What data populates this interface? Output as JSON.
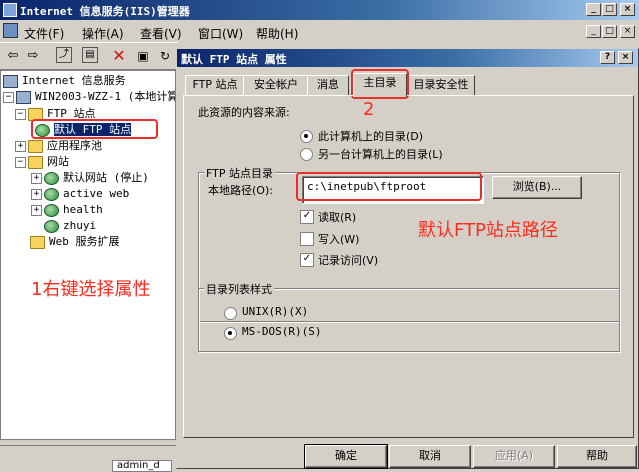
{
  "window": {
    "title": "Internet 信息服务(IIS)管理器",
    "controls": [
      "_",
      "□",
      "×"
    ],
    "inner_controls": [
      "_",
      "□",
      "×"
    ]
  },
  "menu": [
    "文件(F)",
    "操作(A)",
    "查看(V)",
    "窗口(W)",
    "帮助(H)"
  ],
  "toolbar_icons": [
    "back-icon",
    "forward-icon",
    "up-folder-icon",
    "show-tree-icon",
    "delete-icon",
    "properties-icon"
  ],
  "tree": {
    "root": "Internet 信息服务",
    "server": "WIN2003-WZZ-1 (本地计算机)",
    "ftp_sites": "FTP 站点",
    "default_ftp": "默认 FTP 站点",
    "app_pools": "应用程序池",
    "websites": "网站",
    "site1": "默认网站 (停止)",
    "site2": "active web",
    "site3": "health",
    "site4": "zhuyi",
    "web_ext": "Web 服务扩展"
  },
  "status": {
    "taskbar_item": "admin_d"
  },
  "annotations": {
    "step1": "1右键选择属性",
    "step2": "2",
    "path_note": "默认FTP站点路径",
    "color": "#ff2a1c"
  },
  "dialog": {
    "title": "默认 FTP 站点 属性",
    "help_btn": "?",
    "close_btn": "×",
    "tabs": [
      "FTP 站点",
      "安全帐户",
      "消息",
      "主目录",
      "目录安全性"
    ],
    "active_tab": "主目录",
    "content_source_label": "此资源的内容来源:",
    "radio_local": "此计算机上的目录(D)",
    "radio_share": "另一台计算机上的目录(L)",
    "ftp_dir_group": "FTP 站点目录",
    "local_path_label": "本地路径(O):",
    "local_path_value": "c:\\inetpub\\ftproot",
    "browse_btn": "浏览(B)...",
    "read_label": "读取(R)",
    "write_label": "写入(W)",
    "log_label": "记录访问(V)",
    "read_checked": true,
    "write_checked": false,
    "log_checked": true,
    "listing_group": "目录列表样式",
    "unix_label": "UNIX(R)(X)",
    "msdos_label": "MS-DOS(R)(S)",
    "ok_btn": "确定",
    "cancel_btn": "取消",
    "apply_btn": "应用(A)",
    "help_btn_label": "帮助"
  }
}
